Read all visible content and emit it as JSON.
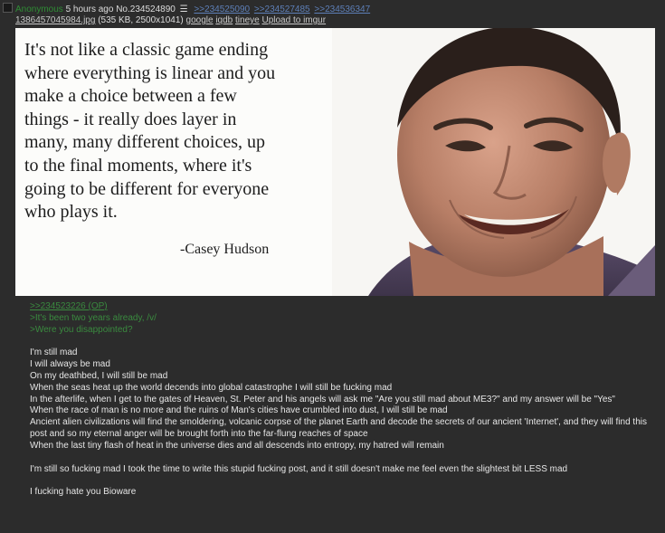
{
  "header": {
    "name": "Anonymous",
    "time": "5 hours ago",
    "post_no": "No.234524890",
    "backlinks": [
      ">>234525090",
      ">>234527485",
      ">>234536347"
    ]
  },
  "file": {
    "filename": "1386457045984.jpg",
    "meta": "(535 KB, 2500x1041)",
    "links": [
      "google",
      "iqdb",
      "tineye",
      "Upload to imgur"
    ]
  },
  "image": {
    "quote_lines": [
      "It's not like a classic game ending",
      "where everything is linear and you",
      "make a choice between a few",
      "things - it really does layer in",
      "many, many different choices, up",
      "to the final moments, where it's",
      "going to be different for everyone",
      "who plays it."
    ],
    "author": "-Casey Hudson"
  },
  "body": {
    "quotelink": ">>234523226 (OP)",
    "greentext": [
      ">It's been two years already, /v/",
      ">Were you disappointed?"
    ],
    "lines": [
      "I'm still mad",
      "I will always be mad",
      "On my deathbed, I will still be mad",
      "When the seas heat up the world decends into global catastrophe I will still be fucking mad",
      "In the afterlife, when I get to the gates of Heaven, St. Peter and his angels will ask me \"Are you still mad about ME3?\" and my answer will be \"Yes\"",
      "When the race of man is no more and the ruins of Man's cities have crumbled into dust, I will still be mad",
      "Ancient alien civilizations will find the smoldering, volcanic corpse of the planet Earth and decode the secrets of our ancient 'Internet', and they will find this post and so my eternal anger will be brought forth into the far-flung reaches of space",
      "When the last tiny flash of heat in the universe dies and all descends into entropy, my hatred will remain"
    ],
    "closing1": "I'm still so fucking mad I took the time to write this stupid fucking post, and it still doesn't make me feel even the slightest bit LESS mad",
    "closing2": "I fucking hate you Bioware"
  }
}
